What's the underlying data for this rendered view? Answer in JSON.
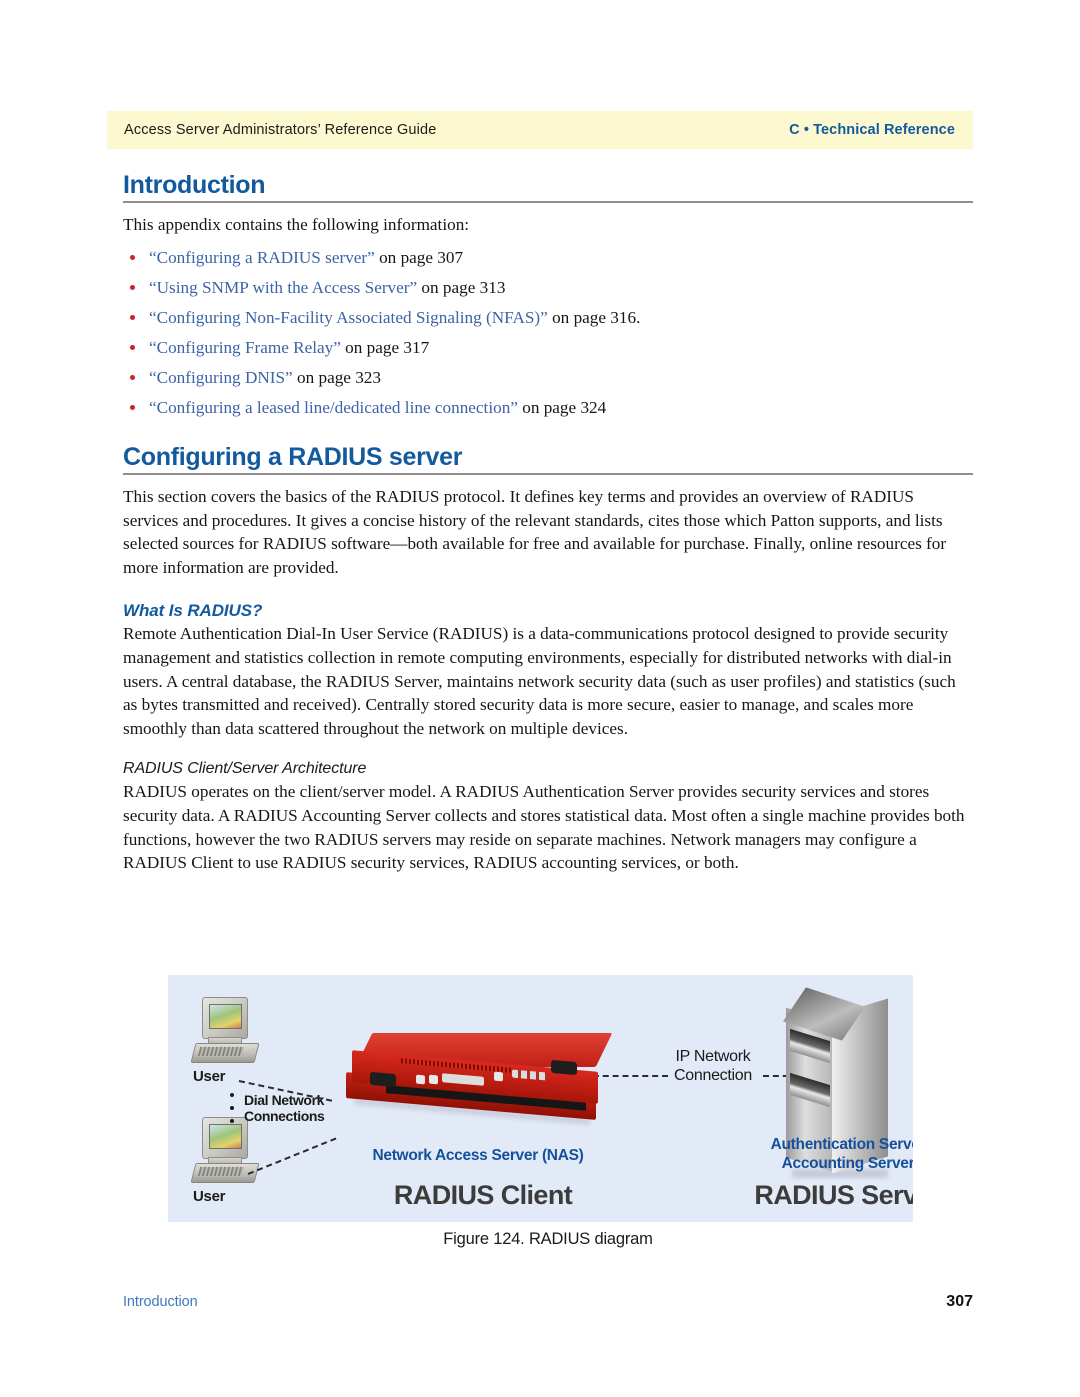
{
  "header": {
    "left_text": "Access Server Administrators’ Reference Guide",
    "right_text": "C • Technical Reference",
    "band_color": "#fcf8cf",
    "accent_color": "#13599d"
  },
  "sections": {
    "introduction": {
      "heading": "Introduction",
      "intro_paragraph": "This appendix contains the following information:",
      "links": [
        {
          "title": "“Configuring a RADIUS server”",
          "tail": " on page 307"
        },
        {
          "title": "“Using SNMP with the Access Server”",
          "tail": " on page 313"
        },
        {
          "title": "“Configuring Non-Facility Associated Signaling (NFAS)”",
          "tail": " on page 316."
        },
        {
          "title": "“Configuring Frame Relay”",
          "tail": " on page 317"
        },
        {
          "title": "“Configuring DNIS”",
          "tail": " on page 323"
        },
        {
          "title": "“Configuring a leased line/dedicated line connection”",
          "tail": " on page 324"
        }
      ],
      "bullet_color": "#c9222a",
      "link_color": "#3c63a6"
    },
    "configuring_radius": {
      "heading": "Configuring a RADIUS server",
      "paragraph": "This section covers the basics of the RADIUS protocol. It defines key terms and provides an overview of RADIUS services and procedures. It gives a concise history of the relevant standards, cites those which Patton supports, and lists selected sources for RADIUS software—both available for free and available for purchase. Finally, online resources for more information are provided."
    },
    "what_is_radius": {
      "heading": "What Is RADIUS?",
      "paragraph": "Remote Authentication Dial-In User Service (RADIUS) is a data-communications protocol designed to provide security management and statistics collection in remote computing environments, especially for distributed networks with dial-in users. A central database, the RADIUS Server, maintains network security data (such as user profiles) and statistics (such as bytes transmitted and received). Centrally stored security data is more secure, easier to manage, and scales more smoothly than data scattered throughout the network on multiple devices."
    },
    "client_server_architecture": {
      "heading": "RADIUS Client/Server Architecture",
      "paragraph": "RADIUS operates on the client/server model. A RADIUS Authentication Server provides security services and stores security data. A RADIUS Accounting Server collects and stores statistical data. Most often a single machine provides both functions, however the two RADIUS servers may reside on separate machines. Network managers may configure a RADIUS Client to use RADIUS security services, RADIUS accounting services, or both."
    }
  },
  "figure": {
    "caption": "Figure 124. RADIUS diagram",
    "background_color": "#e3eaf7",
    "labels": {
      "user_top": "User",
      "user_bottom": "User",
      "dial_network": "Dial Network\nConnections",
      "dial_network_line1": "Dial Network",
      "dial_network_line2": "Connections",
      "ip_network_line1": "IP Network",
      "ip_network_line2": "Connection",
      "nas": "Network Access Server (NAS)",
      "server_line1": "Authentication Server",
      "server_line2": "Accounting Server",
      "big_client": "RADIUS Client",
      "big_server": "RADIUS Server"
    },
    "label_color": "#15509c",
    "big_label_color": "#3c3c3c"
  },
  "footer": {
    "left_text": "Introduction",
    "page_number": "307"
  }
}
